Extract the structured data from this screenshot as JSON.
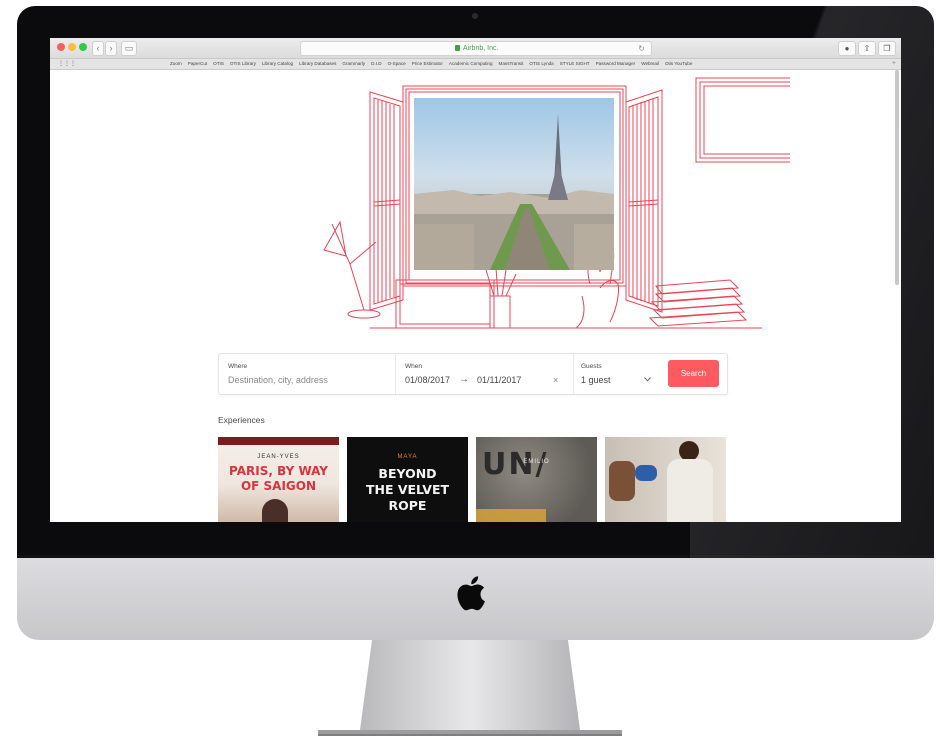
{
  "browser": {
    "url": "Airbnb, Inc.",
    "bookmarks": [
      "Zoom",
      "PaperCut",
      "OTIS",
      "OTIS Library",
      "Library Catalog",
      "Library Databases",
      "Grammarly",
      "D.I.D",
      "O-Space",
      "Price Estimator",
      "Academic Computing",
      "MassTransit",
      "OTIS Lynda",
      "STYLE SIGHT",
      "Password Manager",
      "Webmail",
      "Otis YouTube"
    ]
  },
  "search": {
    "where_label": "Where",
    "where_placeholder": "Destination, city, address",
    "when_label": "When",
    "check_in": "01/08/2017",
    "arrow": "→",
    "check_out": "01/11/2017",
    "clear": "×",
    "guests_label": "Guests",
    "guests_value": "1 guest",
    "button_label": "Search"
  },
  "experiences": {
    "heading": "Experiences",
    "cards": [
      {
        "host": "JEAN-YVES",
        "title_line1": "PARIS, BY WAY",
        "title_line2": "OF SAIGON"
      },
      {
        "host": "MAYA",
        "title_line1": "BEYOND",
        "title_line2": "THE VELVET",
        "title_line3": "ROPE"
      },
      {
        "host": "EMILIO"
      },
      {}
    ]
  },
  "colors": {
    "accent": "#ff5a5f",
    "illustration": "#e94457"
  }
}
